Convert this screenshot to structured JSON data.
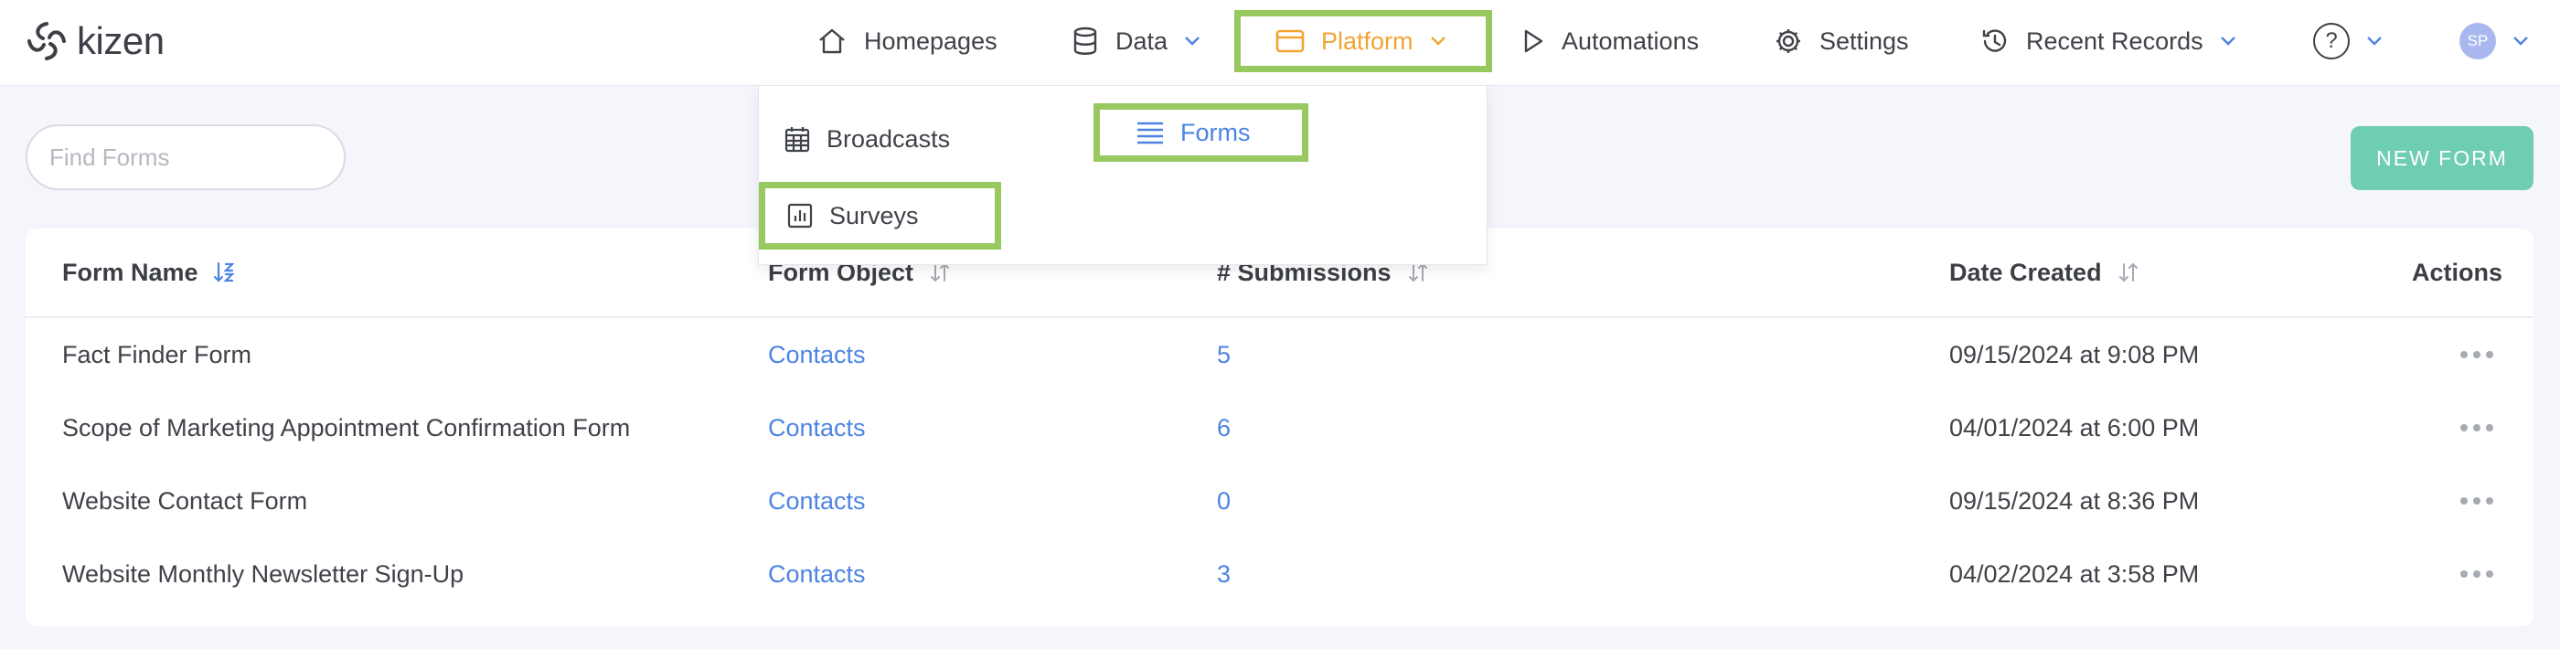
{
  "app": {
    "logo_text": "kizen"
  },
  "nav": {
    "homepages": "Homepages",
    "data": "Data",
    "platform": "Platform",
    "automations": "Automations",
    "settings": "Settings",
    "recent_records": "Recent Records",
    "help_icon_text": "?",
    "avatar_initials": "SP"
  },
  "platform_menu": {
    "broadcasts": "Broadcasts",
    "forms": "Forms",
    "surveys": "Surveys"
  },
  "search": {
    "placeholder": "Find Forms"
  },
  "new_form_button": "NEW FORM",
  "table": {
    "columns": {
      "form_name": "Form Name",
      "form_object": "Form Object",
      "submissions": "# Submissions",
      "date_created": "Date Created",
      "actions": "Actions"
    },
    "rows": [
      {
        "name": "Fact Finder Form",
        "object": "Contacts",
        "submissions": "5",
        "date": "09/15/2024",
        "at": "at",
        "time": "9:08 PM"
      },
      {
        "name": "Scope of Marketing Appointment Confirmation Form",
        "object": "Contacts",
        "submissions": "6",
        "date": "04/01/2024",
        "at": "at",
        "time": "6:00 PM"
      },
      {
        "name": "Website Contact Form",
        "object": "Contacts",
        "submissions": "0",
        "date": "09/15/2024",
        "at": "at",
        "time": "8:36 PM"
      },
      {
        "name": "Website Monthly Newsletter Sign-Up",
        "object": "Contacts",
        "submissions": "3",
        "date": "04/02/2024",
        "at": "at",
        "time": "3:58 PM"
      }
    ]
  },
  "colors": {
    "accent_orange": "#f2a433",
    "link_blue": "#4d84e4",
    "button_teal": "#6fcdb2",
    "highlight_green": "#98c961"
  }
}
